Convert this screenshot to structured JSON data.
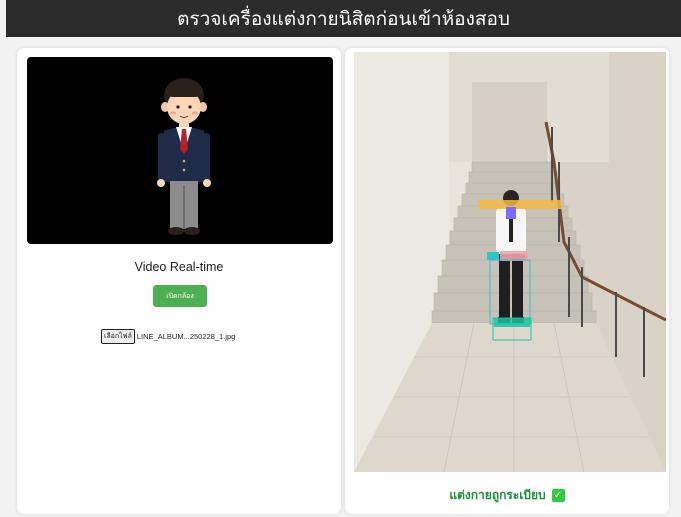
{
  "header": {
    "title": "ตรวจเครื่องแต่งกายนิสิตก่อนเข้าห้องสอบ"
  },
  "left_panel": {
    "video_label": "Video Real-time",
    "camera_button_label": "เปิดกล้อง",
    "file_button_label": "เลือกไฟล์",
    "file_name": "LINE_ALBUM...250228_1.jpg"
  },
  "right_panel": {
    "result_text": "แต่งกายถูกระเบียบ",
    "result_icon": "check-mark-icon",
    "detection_colors": {
      "shirt": "#ffffff",
      "box_tie": "#7b6cff",
      "box_belt": "#2ec4c8",
      "box_label": "#f5b940",
      "box_shoes": "#1ac6a0"
    }
  },
  "colors": {
    "header_bg": "#2c2c2c",
    "button_green": "#4caf50",
    "result_green": "#1e8f3a"
  }
}
